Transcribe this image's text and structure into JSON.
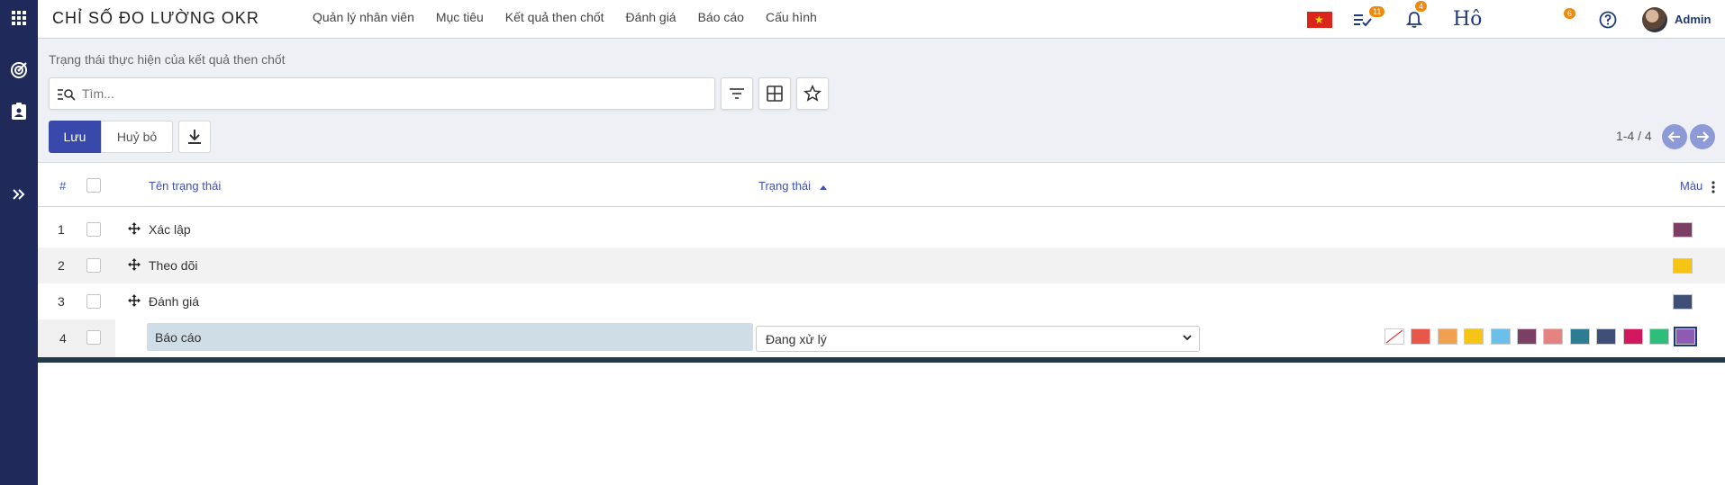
{
  "app": {
    "brand": "CHỈ SỐ ĐO LƯỜNG OKR"
  },
  "menu": [
    "Quản lý nhân viên",
    "Mục tiêu",
    "Kết quả then chốt",
    "Đánh giá",
    "Báo cáo",
    "Cấu hình"
  ],
  "topbar": {
    "activity_count": "11",
    "notification_count": "4",
    "ho_text": "Hô",
    "ho_badge": "6",
    "user_name": "Admin"
  },
  "breadcrumb": "Trạng thái thực hiện của kết quả then chốt",
  "search": {
    "placeholder": "Tìm..."
  },
  "buttons": {
    "save": "Lưu",
    "cancel": "Huỷ bỏ"
  },
  "pager": "1-4 / 4",
  "table": {
    "headers": {
      "num": "#",
      "name": "Tên trạng thái",
      "status": "Trạng thái",
      "color": "Màu"
    },
    "rows": [
      {
        "num": "1",
        "name": "Xác lập",
        "color": "#7a3f63"
      },
      {
        "num": "2",
        "name": "Theo dõi",
        "color": "#f6c415"
      },
      {
        "num": "3",
        "name": "Đánh giá",
        "color": "#3f4e74"
      }
    ],
    "edit_row": {
      "num": "4",
      "name": "Báo cáo",
      "status": "Đang xử lý",
      "palette": [
        "#ffffff",
        "#e8574a",
        "#f0a150",
        "#f6c415",
        "#6cbfe8",
        "#7a3f63",
        "#e58380",
        "#2c7d92",
        "#3f4e74",
        "#d1185f",
        "#2ebd7b",
        "#8e5bb3"
      ],
      "selected_color": "#8e5bb3"
    }
  }
}
